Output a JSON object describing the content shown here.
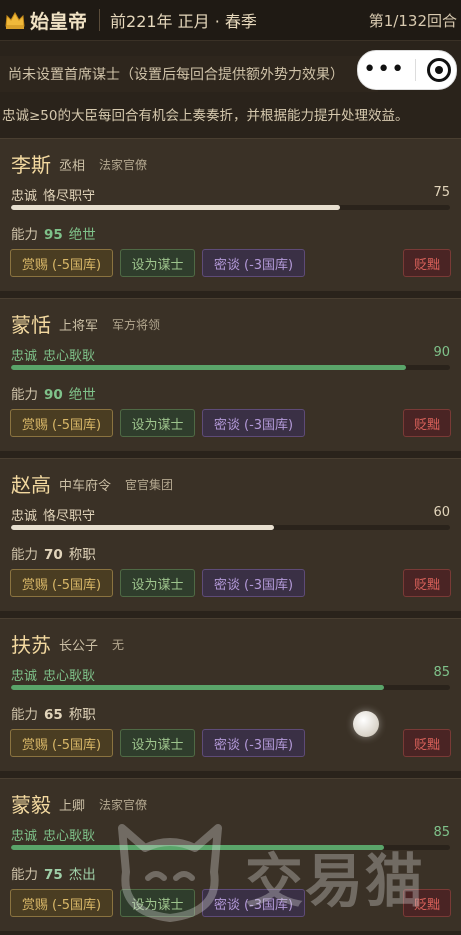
{
  "header": {
    "title": "始皇帝",
    "date": "前221年 正月 · 春季",
    "round": "第1/132回合"
  },
  "advisor_status": "尚未设置首席谋士（设置后每回合提供额外势力效果）",
  "info_text": "忠诚≥50的大臣每回合有机会上奏奏折，并根据能力提升处理效益。",
  "buttons": {
    "reward": "赏赐 (-5国库)",
    "set_advisor": "设为谋士",
    "secret_talk": "密谈 (-3国库)",
    "demote": "贬黜"
  },
  "ministers": [
    {
      "name": "李斯",
      "title": "丞相",
      "faction": "法家官僚",
      "loyalty_label": "忠诚",
      "loyalty_desc": "恪尽职守",
      "loyalty": 75,
      "ability_label": "能力",
      "ability": 95,
      "ability_desc": "绝世",
      "bar_color": "#e8e0d0",
      "text_color": "#e2d5bb",
      "ability_color": "#7fc28a"
    },
    {
      "name": "蒙恬",
      "title": "上将军",
      "faction": "军方将领",
      "loyalty_label": "忠诚",
      "loyalty_desc": "忠心耿耿",
      "loyalty": 90,
      "ability_label": "能力",
      "ability": 90,
      "ability_desc": "绝世",
      "bar_color": "#5aa56a",
      "text_color": "#7fc28a",
      "ability_color": "#7fc28a"
    },
    {
      "name": "赵高",
      "title": "中车府令",
      "faction": "宦官集团",
      "loyalty_label": "忠诚",
      "loyalty_desc": "恪尽职守",
      "loyalty": 60,
      "ability_label": "能力",
      "ability": 70,
      "ability_desc": "称职",
      "bar_color": "#e8e0d0",
      "text_color": "#e2d5bb",
      "ability_color": "#e2d5bb"
    },
    {
      "name": "扶苏",
      "title": "长公子",
      "faction": "无",
      "loyalty_label": "忠诚",
      "loyalty_desc": "忠心耿耿",
      "loyalty": 85,
      "ability_label": "能力",
      "ability": 65,
      "ability_desc": "称职",
      "bar_color": "#5aa56a",
      "text_color": "#7fc28a",
      "ability_color": "#e2d5bb"
    },
    {
      "name": "蒙毅",
      "title": "上卿",
      "faction": "法家官僚",
      "loyalty_label": "忠诚",
      "loyalty_desc": "忠心耿耿",
      "loyalty": 85,
      "ability_label": "能力",
      "ability": 75,
      "ability_desc": "杰出",
      "bar_color": "#5aa56a",
      "text_color": "#7fc28a",
      "ability_color": "#9fd0a8"
    }
  ],
  "watermark": "交易猫",
  "icons": {
    "crown": "crown-icon",
    "more": "more-dots-icon",
    "close": "close-target-icon",
    "float": "floating-ball-icon"
  }
}
